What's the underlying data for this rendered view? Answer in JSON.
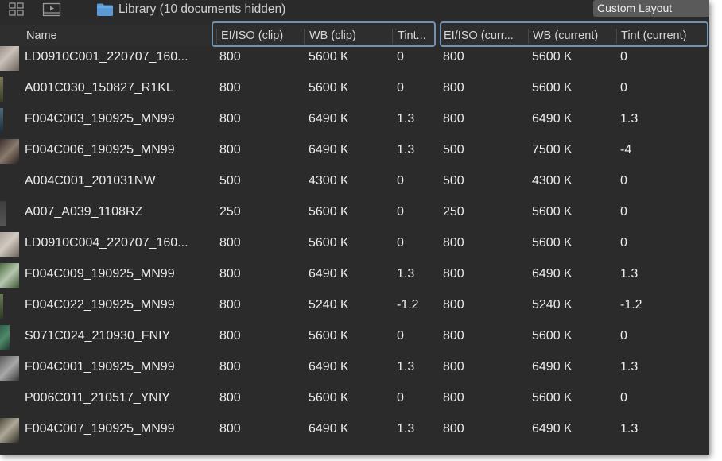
{
  "toolbar": {
    "grid_view_icon": "grid-icon",
    "filmstrip_icon": "filmstrip-icon",
    "folder_icon": "folder-icon",
    "library_label": "Library (10 documents hidden)",
    "layout_select": "Custom Layout"
  },
  "columns": {
    "name": "Name",
    "ei_clip": "EI/ISO (clip)",
    "wb_clip": "WB (clip)",
    "tint_clip": "Tint...",
    "ei_current": "EI/ISO (curr...",
    "wb_current": "WB (current)",
    "tint_current": "Tint (current)"
  },
  "colors": {
    "background": "#2b2b2b",
    "highlight_border": "#6f93b4",
    "folder": "#5a9bd6"
  },
  "rows": [
    {
      "name": "LD0910C001_220707_160...",
      "ei_clip": "800",
      "wb_clip": "5600 K",
      "tint_clip": "0",
      "ei_current": "800",
      "wb_current": "5600 K",
      "tint_current": "0"
    },
    {
      "name": "A001C030_150827_R1KL",
      "ei_clip": "800",
      "wb_clip": "5600 K",
      "tint_clip": "0",
      "ei_current": "800",
      "wb_current": "5600 K",
      "tint_current": "0"
    },
    {
      "name": "F004C003_190925_MN99",
      "ei_clip": "800",
      "wb_clip": "6490 K",
      "tint_clip": "1.3",
      "ei_current": "800",
      "wb_current": "6490 K",
      "tint_current": "1.3"
    },
    {
      "name": "F004C006_190925_MN99",
      "ei_clip": "800",
      "wb_clip": "6490 K",
      "tint_clip": "1.3",
      "ei_current": "500",
      "wb_current": "7500 K",
      "tint_current": "-4"
    },
    {
      "name": "A004C001_201031NW",
      "ei_clip": "500",
      "wb_clip": "4300 K",
      "tint_clip": "0",
      "ei_current": "500",
      "wb_current": "4300 K",
      "tint_current": "0"
    },
    {
      "name": "A007_A039_1108RZ",
      "ei_clip": "250",
      "wb_clip": "5600 K",
      "tint_clip": "0",
      "ei_current": "250",
      "wb_current": "5600 K",
      "tint_current": "0"
    },
    {
      "name": "LD0910C004_220707_160...",
      "ei_clip": "800",
      "wb_clip": "5600 K",
      "tint_clip": "0",
      "ei_current": "800",
      "wb_current": "5600 K",
      "tint_current": "0"
    },
    {
      "name": "F004C009_190925_MN99",
      "ei_clip": "800",
      "wb_clip": "6490 K",
      "tint_clip": "1.3",
      "ei_current": "800",
      "wb_current": "6490 K",
      "tint_current": "1.3"
    },
    {
      "name": "F004C022_190925_MN99",
      "ei_clip": "800",
      "wb_clip": "5240 K",
      "tint_clip": "-1.2",
      "ei_current": "800",
      "wb_current": "5240 K",
      "tint_current": "-1.2"
    },
    {
      "name": "S071C024_210930_FNIY",
      "ei_clip": "800",
      "wb_clip": "5600 K",
      "tint_clip": "0",
      "ei_current": "800",
      "wb_current": "5600 K",
      "tint_current": "0"
    },
    {
      "name": "F004C001_190925_MN99",
      "ei_clip": "800",
      "wb_clip": "6490 K",
      "tint_clip": "1.3",
      "ei_current": "800",
      "wb_current": "6490 K",
      "tint_current": "1.3"
    },
    {
      "name": "P006C011_210517_YNIY",
      "ei_clip": "800",
      "wb_clip": "5600 K",
      "tint_clip": "0",
      "ei_current": "800",
      "wb_current": "5600 K",
      "tint_current": "0"
    },
    {
      "name": "F004C007_190925_MN99",
      "ei_clip": "800",
      "wb_clip": "6490 K",
      "tint_clip": "1.3",
      "ei_current": "800",
      "wb_current": "6490 K",
      "tint_current": "1.3"
    }
  ]
}
